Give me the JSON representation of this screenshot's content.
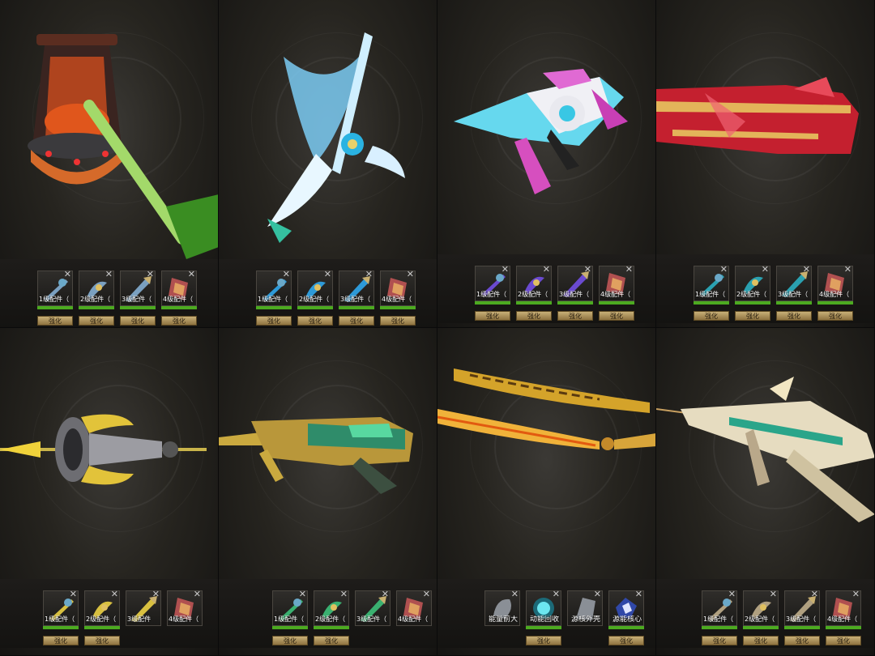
{
  "panels": [
    {
      "weapon_icon": "lantern-hammer-icon",
      "parts": [
        {
          "label": "1级配件（",
          "icon": "part-1-icon",
          "upgrade": "强化",
          "bar": true
        },
        {
          "label": "2级配件（",
          "icon": "part-2-icon",
          "upgrade": "强化",
          "bar": true
        },
        {
          "label": "3级配件（",
          "icon": "part-3-icon",
          "upgrade": "强化",
          "bar": true
        },
        {
          "label": "4级配件（",
          "icon": "part-4-icon",
          "upgrade": "强化",
          "bar": true
        }
      ]
    },
    {
      "weapon_icon": "ice-scythe-icon",
      "parts": [
        {
          "label": "1级配件（",
          "icon": "part-1-icon",
          "upgrade": "强化",
          "bar": true
        },
        {
          "label": "2级配件（",
          "icon": "part-2-icon",
          "upgrade": "强化",
          "bar": true
        },
        {
          "label": "3级配件（",
          "icon": "part-3-icon",
          "upgrade": "强化",
          "bar": true
        },
        {
          "label": "4级配件（",
          "icon": "part-4-icon",
          "upgrade": "强化",
          "bar": true
        }
      ]
    },
    {
      "weapon_icon": "crystal-rifle-icon",
      "parts": [
        {
          "label": "1级配件（",
          "icon": "part-1-icon",
          "upgrade": "强化",
          "bar": true
        },
        {
          "label": "2级配件（",
          "icon": "part-2-icon",
          "upgrade": "强化",
          "bar": true
        },
        {
          "label": "3级配件（",
          "icon": "part-3-icon",
          "upgrade": "强化",
          "bar": true
        },
        {
          "label": "4级配件（",
          "icon": "part-4-icon",
          "upgrade": "强化",
          "bar": true
        }
      ]
    },
    {
      "weapon_icon": "ruby-cannon-icon",
      "parts": [
        {
          "label": "1级配件（",
          "icon": "part-1-icon",
          "upgrade": "强化",
          "bar": true
        },
        {
          "label": "2级配件（",
          "icon": "part-2-icon",
          "upgrade": "强化",
          "bar": true
        },
        {
          "label": "3级配件（",
          "icon": "part-3-icon",
          "upgrade": "强化",
          "bar": true
        },
        {
          "label": "4级配件（",
          "icon": "part-4-icon",
          "upgrade": "强化",
          "bar": true
        }
      ]
    },
    {
      "weapon_icon": "trident-spear-icon",
      "parts": [
        {
          "label": "1级配件（",
          "icon": "part-1-icon",
          "upgrade": "强化",
          "bar": true
        },
        {
          "label": "2级配件（",
          "icon": "part-2-icon",
          "upgrade": "强化",
          "bar": true
        },
        {
          "label": "3级配件",
          "icon": "part-3-icon",
          "upgrade": "",
          "bar": false
        },
        {
          "label": "4级配件（",
          "icon": "part-4-icon",
          "upgrade": "",
          "bar": false
        }
      ]
    },
    {
      "weapon_icon": "gold-jade-rifle-icon",
      "parts": [
        {
          "label": "1级配件（",
          "icon": "part-1-icon",
          "upgrade": "强化",
          "bar": true
        },
        {
          "label": "2级配件（",
          "icon": "part-2-icon",
          "upgrade": "强化",
          "bar": true
        },
        {
          "label": "3级配件（",
          "icon": "part-3-icon",
          "upgrade": "",
          "bar": false
        },
        {
          "label": "4级配件（",
          "icon": "part-4-icon",
          "upgrade": "",
          "bar": false
        }
      ]
    },
    {
      "weapon_icon": "katana-icon",
      "parts": [
        {
          "label": "能量前大",
          "icon": "energy-icon",
          "upgrade": "",
          "bar": false
        },
        {
          "label": "动能回收",
          "icon": "orb-icon",
          "upgrade": "强化",
          "bar": true
        },
        {
          "label": "源核外壳",
          "icon": "shell-icon",
          "upgrade": "",
          "bar": false
        },
        {
          "label": "源能核心",
          "icon": "core-icon",
          "upgrade": "强化",
          "bar": true
        }
      ]
    },
    {
      "weapon_icon": "golden-bow-rifle-icon",
      "parts": [
        {
          "label": "1级配件（",
          "icon": "part-1-icon",
          "upgrade": "强化",
          "bar": true
        },
        {
          "label": "2级配件（",
          "icon": "part-2-icon",
          "upgrade": "强化",
          "bar": true
        },
        {
          "label": "3级配件（",
          "icon": "part-3-icon",
          "upgrade": "强化",
          "bar": true
        },
        {
          "label": "4级配件（",
          "icon": "part-4-icon",
          "upgrade": "强化",
          "bar": true
        }
      ]
    }
  ],
  "colors": {
    "bar": "#4caa20",
    "button": "#b89a5c",
    "background": "#26241f"
  }
}
